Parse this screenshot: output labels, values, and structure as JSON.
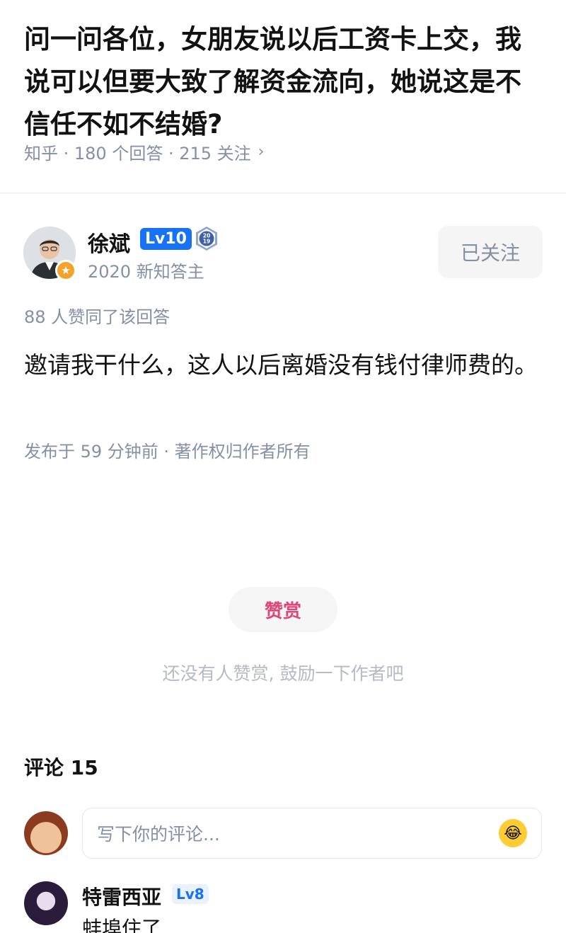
{
  "question": {
    "title": "问一问各位，女朋友说以后工资卡上交，我说可以但要大致了解资金流向，她说这是不信任不如不结婚?",
    "meta": "知乎 · 180 个回答 · 215 关注",
    "chevron": "›"
  },
  "author": {
    "name": "徐斌",
    "level": "Lv10",
    "medal_year": "2019",
    "subtitle": "2020 新知答主",
    "follow_label": "已关注"
  },
  "answer": {
    "votes": "88 人赞同了该回答",
    "text": "邀请我干什么，这人以后离婚没有钱付律师费的。",
    "meta": "发布于 59 分钟前 · 著作权归作者所有"
  },
  "reward": {
    "button_label": "赞赏",
    "hint": "还没有人赞赏, 鼓励一下作者吧"
  },
  "comments": {
    "title": "评论 15",
    "input_placeholder": "写下你的评论...",
    "items": [
      {
        "name": "特雷西亚",
        "level": "Lv8",
        "text": "蚌埠住了"
      }
    ]
  },
  "colors": {
    "accent_blue": "#1772f6",
    "reward_pink": "#e0447a",
    "meta_gray": "#8590a6"
  }
}
